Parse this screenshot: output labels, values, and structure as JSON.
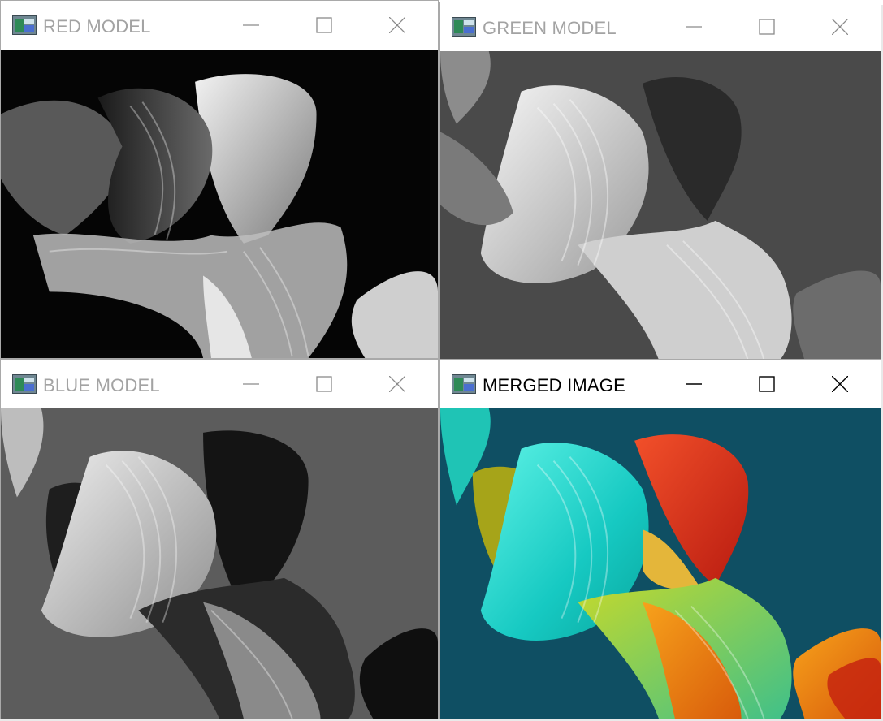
{
  "windows": {
    "red": {
      "title": "RED MODEL"
    },
    "green": {
      "title": "GREEN MODEL"
    },
    "blue": {
      "title": "BLUE MODEL"
    },
    "merged": {
      "title": "MERGED IMAGE"
    }
  },
  "icons": {
    "app": "opencv-window-icon",
    "minimize": "minimize-icon",
    "maximize": "maximize-icon",
    "close": "close-icon"
  },
  "colors": {
    "inactive_title": "#a3a3a3",
    "active_title": "#000000",
    "merged_background": "#0f4f63"
  }
}
